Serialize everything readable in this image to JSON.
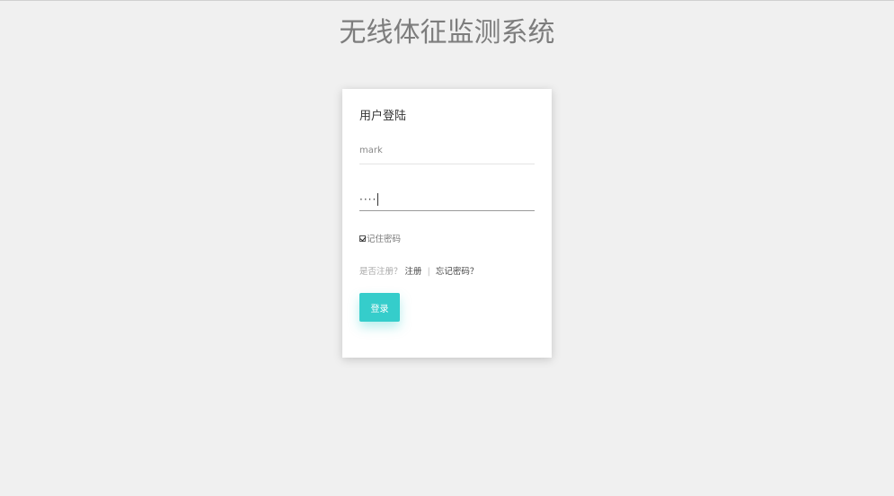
{
  "page": {
    "title": "无线体征监测系统"
  },
  "login": {
    "heading": "用户登陆",
    "username_value": "mark",
    "password_mask": "····",
    "remember_label": "记住密码",
    "register_prompt": "是否注册？",
    "register_link": "注册",
    "separator": "|",
    "forgot_link": "忘记密码？",
    "submit_label": "登录"
  },
  "colors": {
    "accent": "#35cdcb",
    "background": "#f0f0f0",
    "card": "#ffffff"
  }
}
